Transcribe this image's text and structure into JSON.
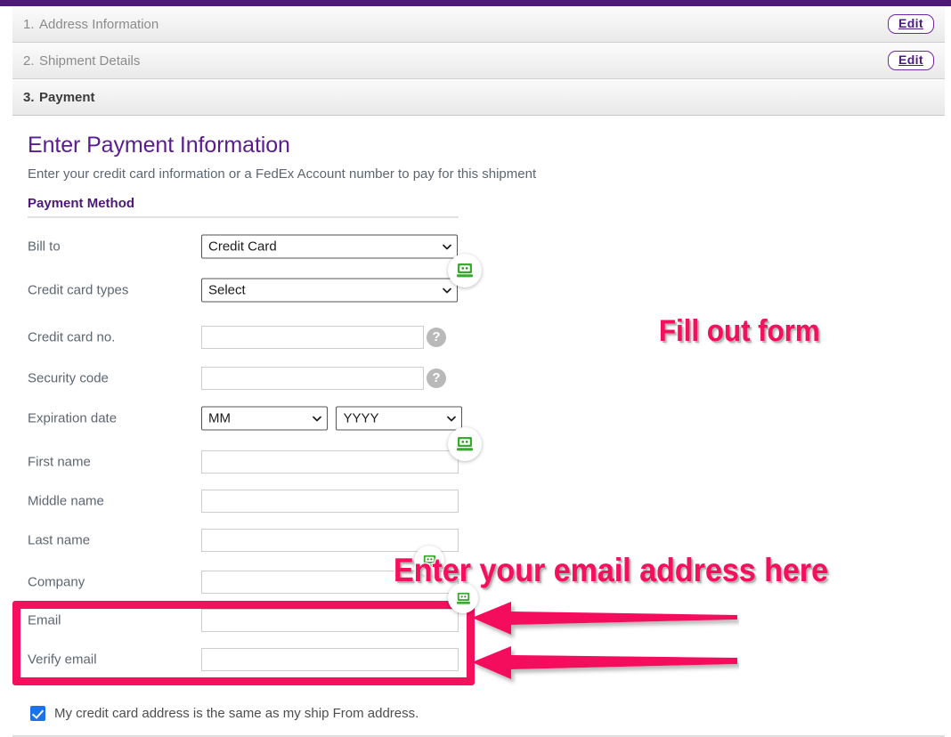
{
  "brand": {
    "purple": "#4d1979",
    "accent_pink": "#f4105c",
    "checkbox_blue": "#1a73e8"
  },
  "accordion": {
    "edit_label": "Edit",
    "steps": [
      {
        "num": "1.",
        "title": "Address Information",
        "has_edit": true,
        "active": false
      },
      {
        "num": "2.",
        "title": "Shipment Details",
        "has_edit": true,
        "active": false
      },
      {
        "num": "3.",
        "title": "Payment",
        "has_edit": false,
        "active": true
      }
    ]
  },
  "payment": {
    "title": "Enter Payment Information",
    "subtitle": "Enter your credit card information or a FedEx Account number to pay for this shipment",
    "section_heading": "Payment Method",
    "fields": {
      "bill_to": {
        "label": "Bill to",
        "value": "Credit Card"
      },
      "card_types": {
        "label": "Credit card types",
        "value": "Select"
      },
      "card_no": {
        "label": "Credit card no.",
        "value": ""
      },
      "security_code": {
        "label": "Security code",
        "value": ""
      },
      "expiration": {
        "label": "Expiration date",
        "month": "MM",
        "year": "YYYY"
      },
      "first_name": {
        "label": "First name",
        "value": ""
      },
      "middle_name": {
        "label": "Middle name",
        "value": ""
      },
      "last_name": {
        "label": "Last name",
        "value": ""
      },
      "company": {
        "label": "Company",
        "value": ""
      },
      "email": {
        "label": "Email",
        "value": ""
      },
      "verify_email": {
        "label": "Verify email",
        "value": ""
      }
    },
    "help_icon_char": "?",
    "checkbox": {
      "label": "My credit card address is the same as my ship From address.",
      "checked": true
    }
  },
  "annotations": [
    {
      "text": "Fill out form"
    },
    {
      "text": "Enter your email address here"
    }
  ],
  "icons": {
    "password_manager": "password-manager-robot-icon",
    "chevron": "chevron-down-icon",
    "help": "help-question-icon"
  }
}
